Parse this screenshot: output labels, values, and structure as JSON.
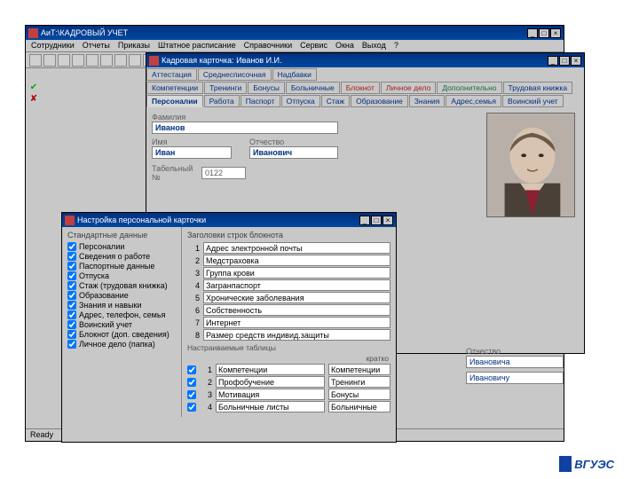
{
  "app": {
    "title": "АиТ:\\КАДРОВЫЙ УЧЕТ",
    "status": "Ready",
    "menu": [
      "Сотрудники",
      "Отчеты",
      "Приказы",
      "Штатное расписание",
      "Справочники",
      "Сервис",
      "Окна",
      "Выход",
      "?"
    ]
  },
  "card": {
    "title": "Кадровая карточка: Иванов И.И.",
    "tabrow1": [
      "Аттестация",
      "Среднесписочная",
      "Надбавки"
    ],
    "tabrow2": [
      {
        "l": "Компетенции",
        "c": ""
      },
      {
        "l": "Тренинги",
        "c": ""
      },
      {
        "l": "Бонусы",
        "c": ""
      },
      {
        "l": "Больничные",
        "c": ""
      },
      {
        "l": "Блокнот",
        "c": "red"
      },
      {
        "l": "Личное дело",
        "c": "red"
      },
      {
        "l": "Дополнительно",
        "c": "green"
      },
      {
        "l": "Трудовая книжка",
        "c": ""
      }
    ],
    "tabrow3": [
      {
        "l": "Персоналии",
        "a": true
      },
      {
        "l": "Работа"
      },
      {
        "l": "Паспорт"
      },
      {
        "l": "Отпуска"
      },
      {
        "l": "Стаж"
      },
      {
        "l": "Образование"
      },
      {
        "l": "Знания"
      },
      {
        "l": "Адрес,семья"
      },
      {
        "l": "Воинский учет"
      }
    ],
    "fields": {
      "surname_l": "Фамилия",
      "surname": "Иванов",
      "name_l": "Имя",
      "name": "Иван",
      "patr_l": "Отчество",
      "patr": "Иванович",
      "tab_l": "Табельный №",
      "tab": "0122"
    },
    "extra": {
      "patr_l": "Отчество",
      "r1": "Ивановича",
      "r2": "Ивановичу"
    }
  },
  "settings": {
    "title": "Настройка персональной карточки",
    "stdgroup": "Стандартные данные",
    "std": [
      "Персоналии",
      "Сведения о работе",
      "Паспортные данные",
      "Отпуска",
      "Стаж (трудовая книжка)",
      "Образование",
      "Знания и навыки",
      "Адрес, телефон, семья",
      "Воинский учет",
      "Блокнот (доп. сведения)",
      "Личное дело (папка)"
    ],
    "noteshead": "Заголовки строк блокнота",
    "notes": [
      "Адрес электронной почты",
      "Медстраховка",
      "Группа крови",
      "Загранпаспорт",
      "Хронические заболевания",
      "Собственность",
      "Интернет",
      "Размер средств индивид.защиты"
    ],
    "tablhead": "Настраиваемые таблицы",
    "kratko": "кратко",
    "tables": [
      {
        "a": "Компетенции",
        "b": "Компетенции"
      },
      {
        "a": "Профобучение",
        "b": "Тренинги"
      },
      {
        "a": "Мотивация",
        "b": "Бонусы"
      },
      {
        "a": "Больничные листы",
        "b": "Больничные"
      }
    ]
  },
  "footer": "ВГУЭС"
}
